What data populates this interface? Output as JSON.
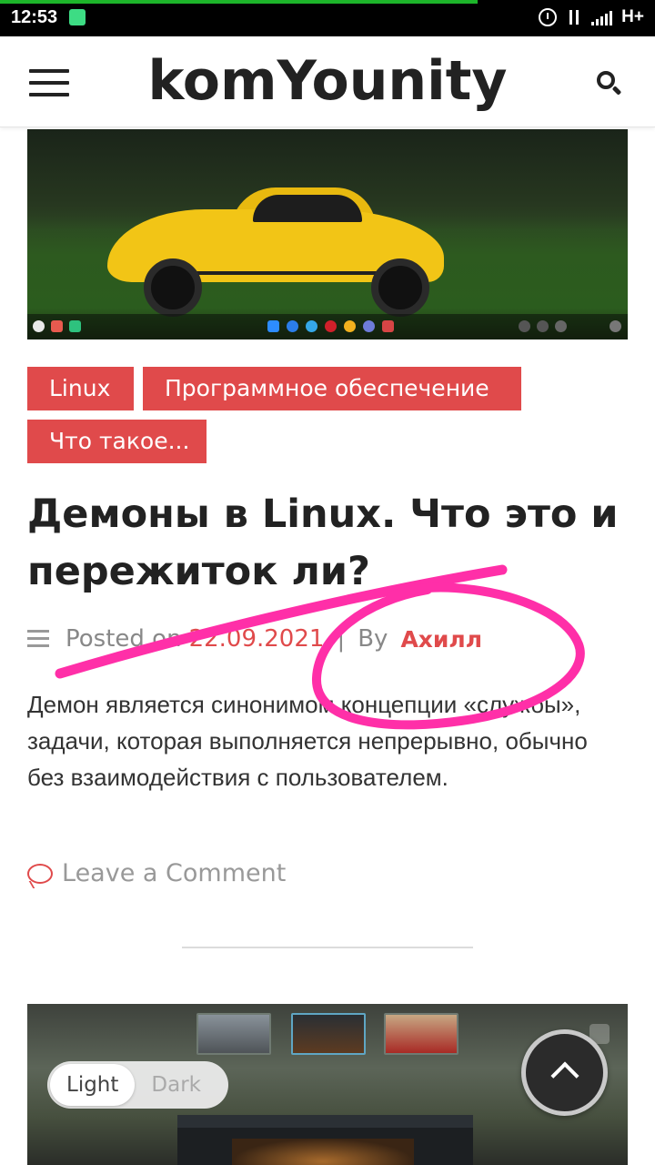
{
  "status_bar": {
    "time": "12:53",
    "network": "H+",
    "accent": "#1db52a"
  },
  "header": {
    "site_title": "komYounity",
    "menu_icon": "hamburger-menu-icon",
    "search_icon": "search-icon"
  },
  "post": {
    "categories": [
      "Linux",
      "Программное обеспечение",
      "Что такое..."
    ],
    "title": "Демоны в Linux. Что это и пережиток ли?",
    "meta": {
      "posted_on_label": "Posted on",
      "date": "22.09.2021",
      "separator": "|",
      "by_label": "By",
      "author": "Ахилл"
    },
    "excerpt": "Демон является синонимом концепции «службы», задачи, которая выполняется непрерывно, обычно без взаимодействия с пользователем.",
    "comment_link": "Leave a Comment"
  },
  "theme_toggle": {
    "light": "Light",
    "dark": "Dark",
    "selected": "Light"
  },
  "back_to_top": {
    "icon": "chevron-up-icon"
  },
  "colors": {
    "accent_red": "#e04a4b",
    "annotation_pink": "#ff2fa8",
    "text_dark": "#222222"
  }
}
